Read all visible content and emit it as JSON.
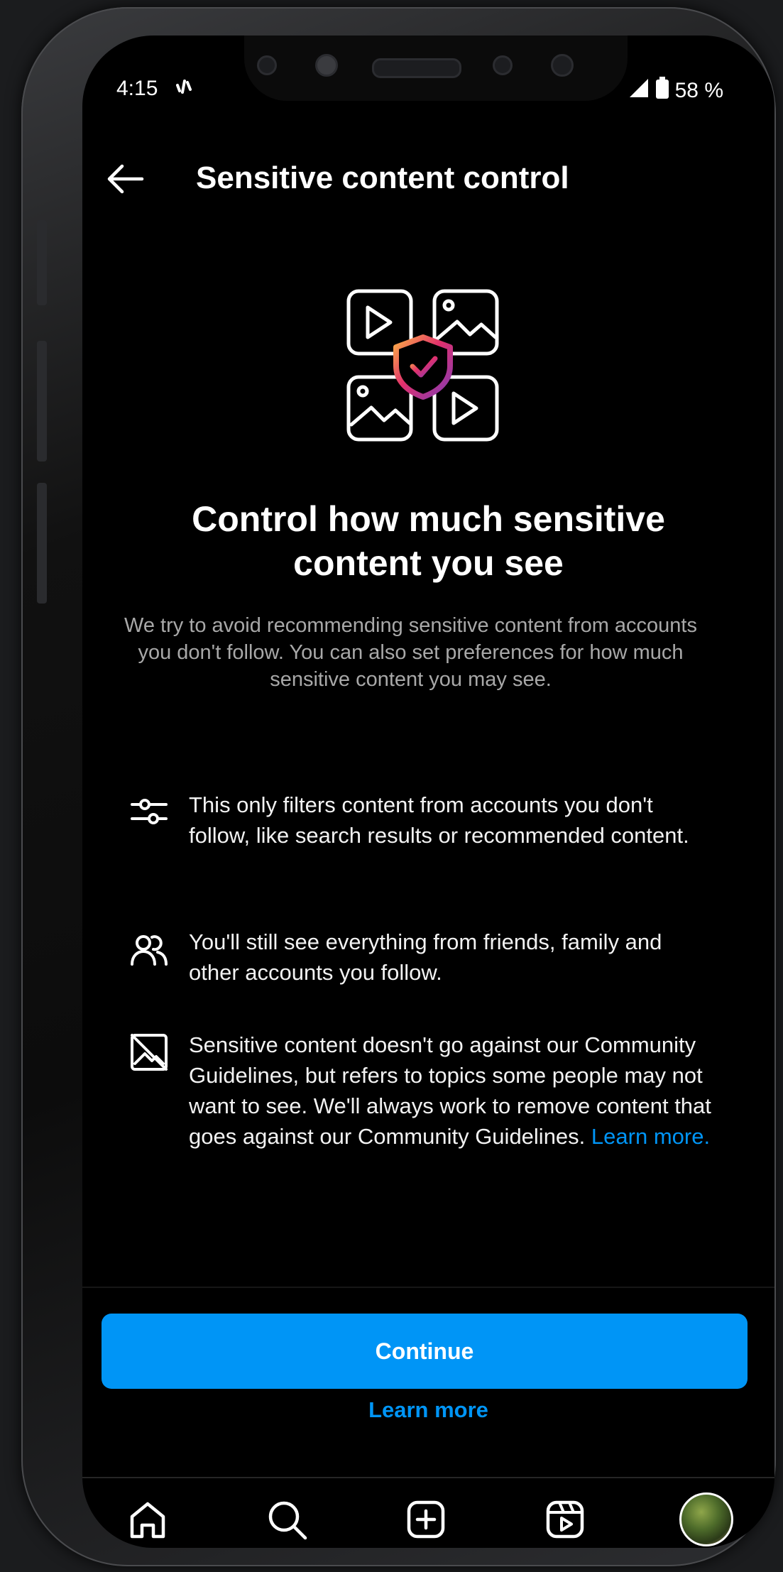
{
  "status_bar": {
    "time": "4:15",
    "battery": "58 %"
  },
  "header": {
    "title": "Sensitive content control"
  },
  "main": {
    "heading": "Control how much sensitive content you see",
    "intro": "We try to avoid recommending sensitive content from accounts you don't follow. You can also set preferences for how much sensitive content you may see.",
    "items": [
      {
        "icon": "sliders-icon",
        "text": "This only filters content from accounts you don't follow, like search results or recommended content."
      },
      {
        "icon": "people-icon",
        "text": "You'll still see everything from friends, family and other accounts you follow."
      },
      {
        "icon": "hidden-image-icon",
        "text": "Sensitive content doesn't go against our Community Guidelines, but refers to topics some people may not want to see. We'll always work to remove content that goes against our Community Guidelines.",
        "link": "Learn more."
      }
    ]
  },
  "footer": {
    "continue_label": "Continue",
    "learn_more_label": "Learn more"
  },
  "nav": {
    "items": [
      "home-icon",
      "search-icon",
      "create-icon",
      "reels-icon",
      "profile-avatar"
    ]
  },
  "colors": {
    "accent": "#0095f6",
    "background": "#000000",
    "muted_text": "#a8a8a8"
  }
}
